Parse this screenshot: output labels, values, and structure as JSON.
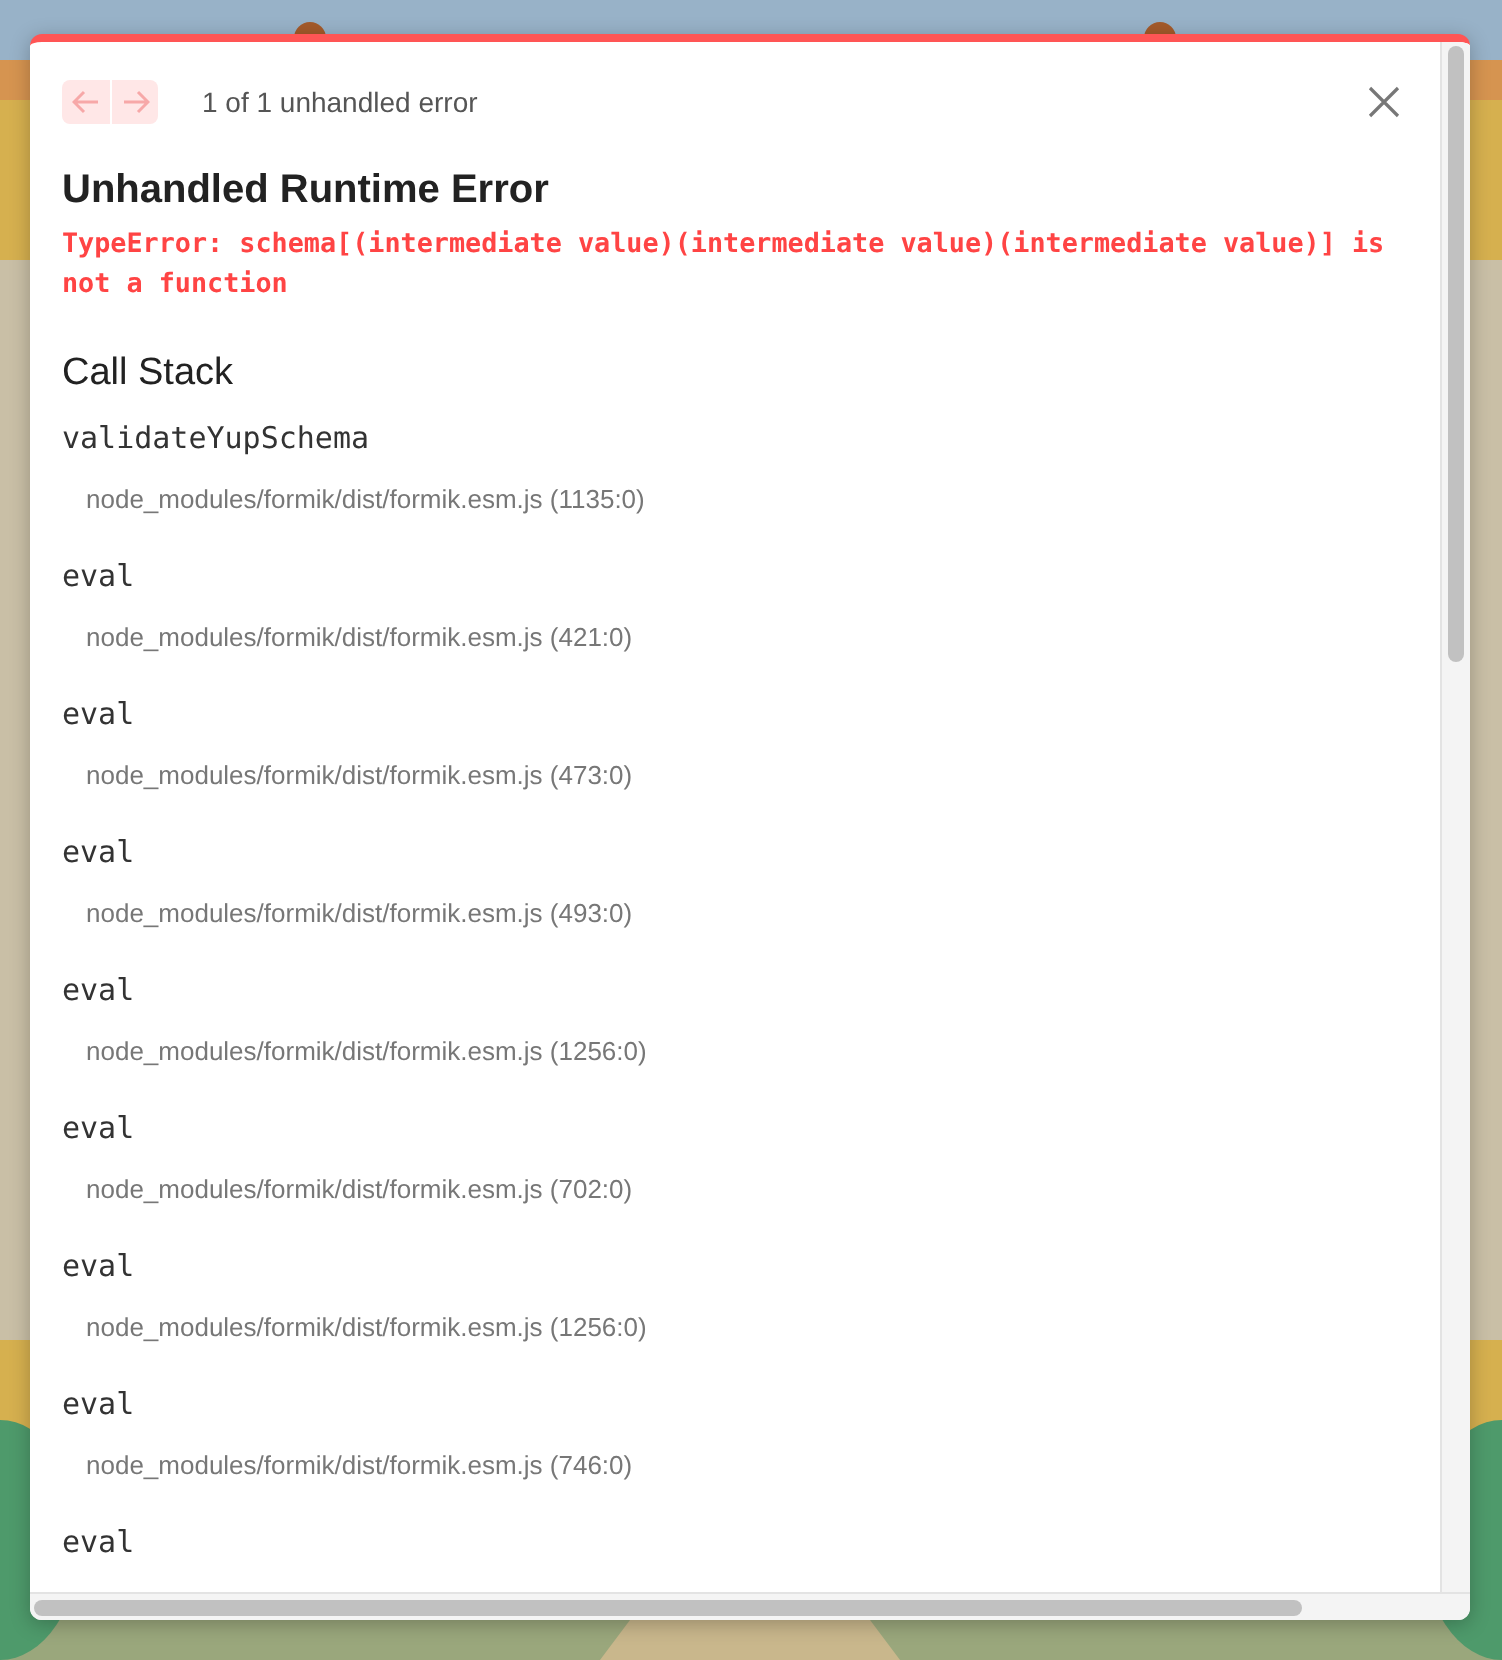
{
  "header": {
    "nav": [
      {
        "kind": "prev",
        "disabled": true
      },
      {
        "kind": "next",
        "disabled": true
      }
    ],
    "count": "1 of 1 unhandled error"
  },
  "error": {
    "title": "Unhandled Runtime Error",
    "message": "TypeError: schema[(intermediate value)(intermediate value)(intermediate value)] is not a function"
  },
  "call_stack": {
    "heading": "Call Stack",
    "frames": [
      {
        "function": "validateYupSchema",
        "location": "node_modules/formik/dist/formik.esm.js (1135:0)"
      },
      {
        "function": "eval",
        "location": "node_modules/formik/dist/formik.esm.js (421:0)"
      },
      {
        "function": "eval",
        "location": "node_modules/formik/dist/formik.esm.js (473:0)"
      },
      {
        "function": "eval",
        "location": "node_modules/formik/dist/formik.esm.js (493:0)"
      },
      {
        "function": "eval",
        "location": "node_modules/formik/dist/formik.esm.js (1256:0)"
      },
      {
        "function": "eval",
        "location": "node_modules/formik/dist/formik.esm.js (702:0)"
      },
      {
        "function": "eval",
        "location": "node_modules/formik/dist/formik.esm.js (1256:0)"
      },
      {
        "function": "eval",
        "location": "node_modules/formik/dist/formik.esm.js (746:0)"
      },
      {
        "function": "eval"
      }
    ]
  }
}
